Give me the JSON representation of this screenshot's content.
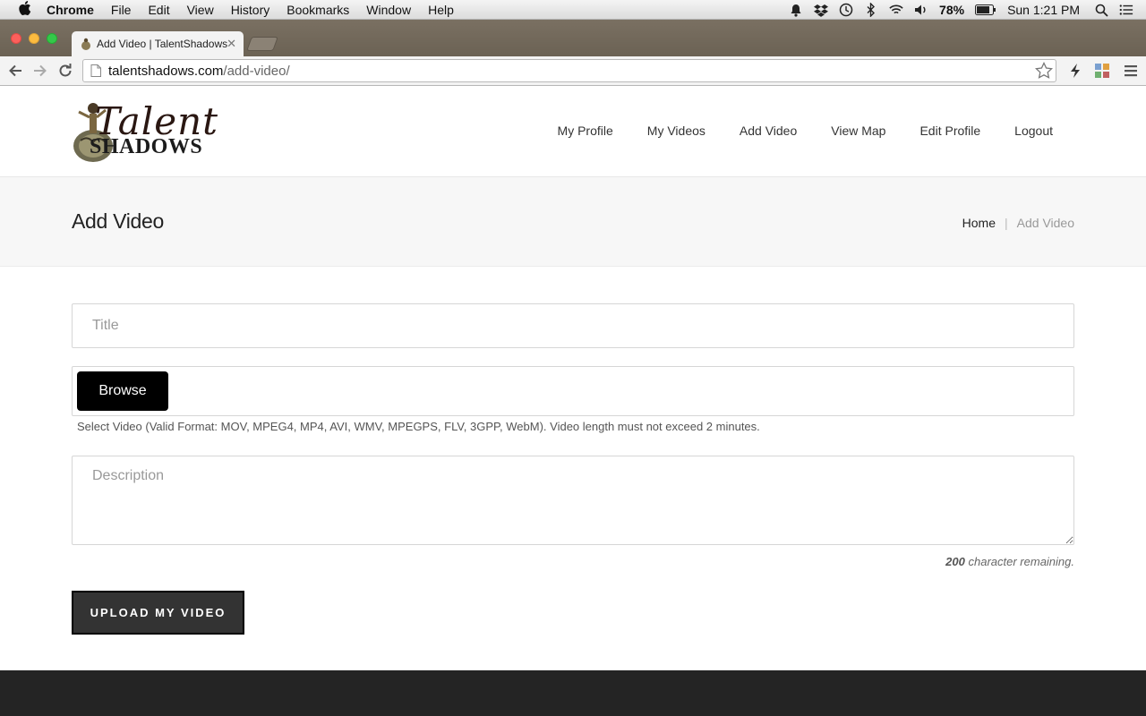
{
  "menubar": {
    "items": [
      "Chrome",
      "File",
      "Edit",
      "View",
      "History",
      "Bookmarks",
      "Window",
      "Help"
    ],
    "battery": "78%",
    "clock": "Sun 1:21 PM"
  },
  "browser": {
    "tab_title": "Add Video | TalentShadows",
    "url_host": "talentshadows.com",
    "url_path": "/add-video/"
  },
  "site": {
    "logo_line1": "Talent",
    "logo_line2": "SHADOWS",
    "nav": [
      "My Profile",
      "My Videos",
      "Add Video",
      "View Map",
      "Edit Profile",
      "Logout"
    ]
  },
  "page": {
    "title": "Add Video",
    "breadcrumb_home": "Home",
    "breadcrumb_sep": "|",
    "breadcrumb_current": "Add Video"
  },
  "form": {
    "title_placeholder": "Title",
    "browse_label": "Browse",
    "file_help": "Select Video (Valid Format: MOV, MPEG4, MP4, AVI, WMV, MPEGPS, FLV, 3GPP, WebM). Video length must not exceed 2 minutes.",
    "description_placeholder": "Description",
    "char_count": "200",
    "char_count_suffix": "character remaining.",
    "submit_label": "UPLOAD MY VIDEO"
  }
}
